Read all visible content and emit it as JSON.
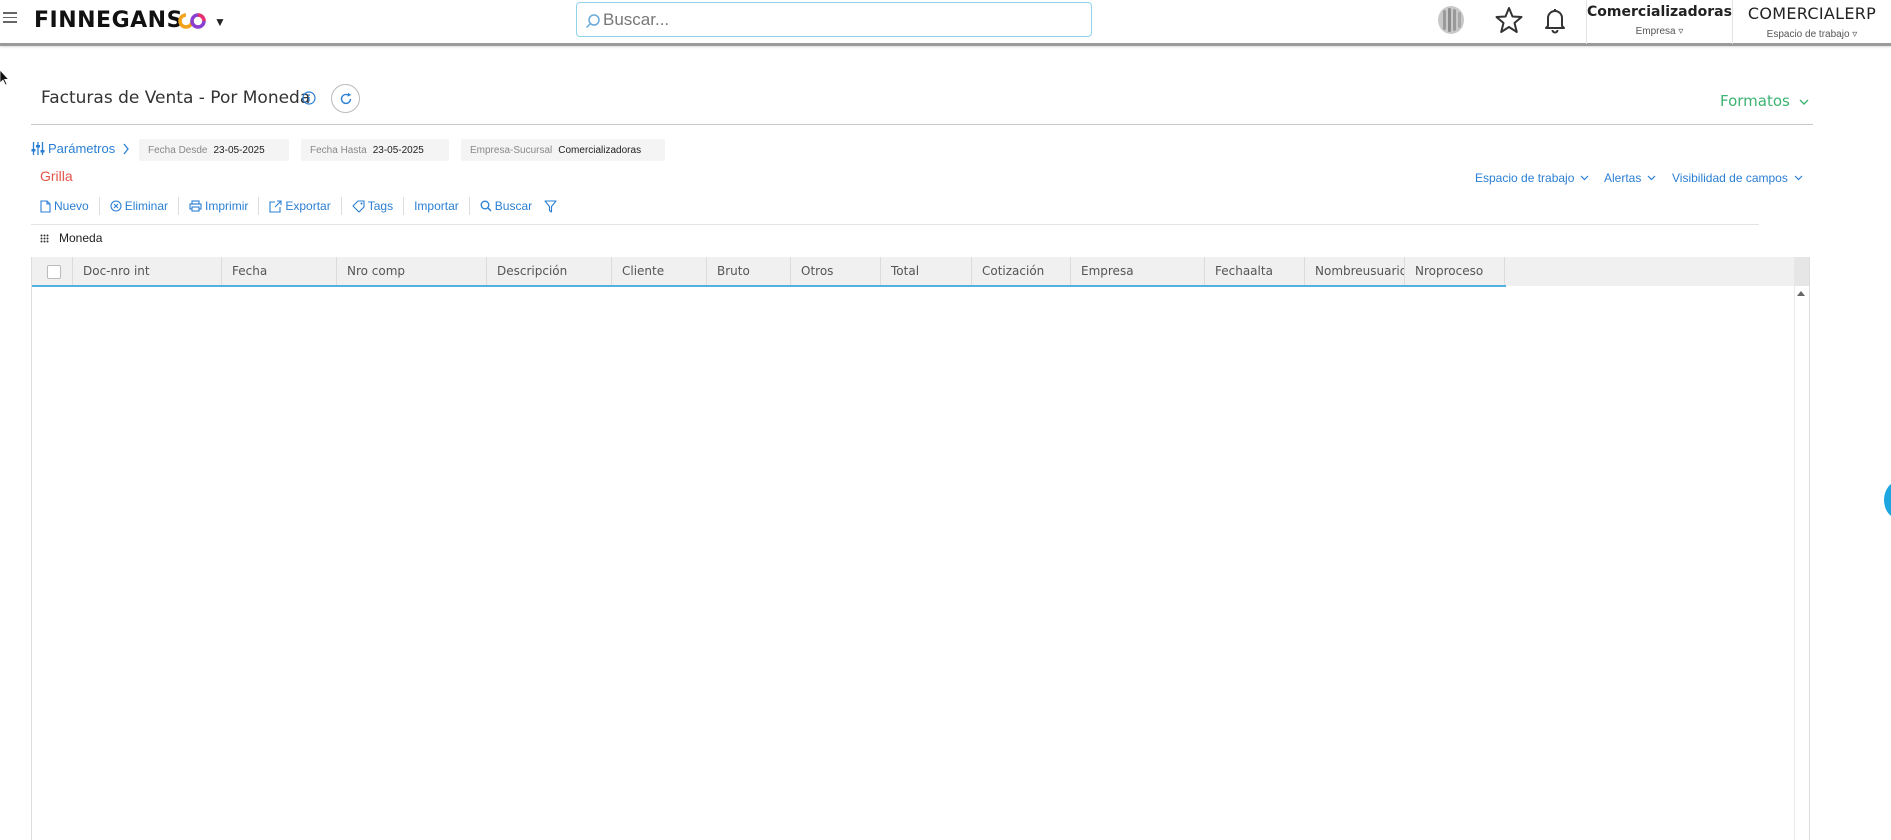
{
  "brand": {
    "name": "FINNEGANS"
  },
  "search": {
    "placeholder": "Buscar..."
  },
  "context": {
    "company_value": "Comercializadoras",
    "company_label": "Empresa ▿",
    "workspace_value": "COMERCIALERP",
    "workspace_label": "Espacio de trabajo ▿"
  },
  "page": {
    "title": "Facturas de Venta - Por Moneda",
    "formats_label": "Formatos"
  },
  "params": {
    "label": "Parámetros",
    "fields": [
      {
        "label": "Fecha Desde",
        "value": "23-05-2025"
      },
      {
        "label": "Fecha Hasta",
        "value": "23-05-2025"
      },
      {
        "label": "Empresa-Sucursal",
        "value": "Comercializadoras"
      }
    ]
  },
  "view": {
    "grid_label": "Grilla"
  },
  "right_links": [
    "Espacio de trabajo",
    "Alertas",
    "Visibilidad de campos"
  ],
  "toolbar": {
    "nuevo": "Nuevo",
    "eliminar": "Eliminar",
    "imprimir": "Imprimir",
    "exportar": "Exportar",
    "tags": "Tags",
    "importar": "Importar",
    "buscar": "Buscar"
  },
  "grouping": {
    "label": "Moneda"
  },
  "grid": {
    "columns": [
      "Doc-nro int",
      "Fecha",
      "Nro comp",
      "Descripción",
      "Cliente",
      "Bruto",
      "Otros",
      "Total",
      "Cotización",
      "Empresa",
      "Fechaalta",
      "Nombreusuario",
      "Nroproceso"
    ],
    "rows": []
  },
  "colors": {
    "accent_blue": "#2a7fd4",
    "formats_green": "#3cb371",
    "grid_label_red": "#e2554a",
    "header_underline": "#4fb3e0"
  }
}
